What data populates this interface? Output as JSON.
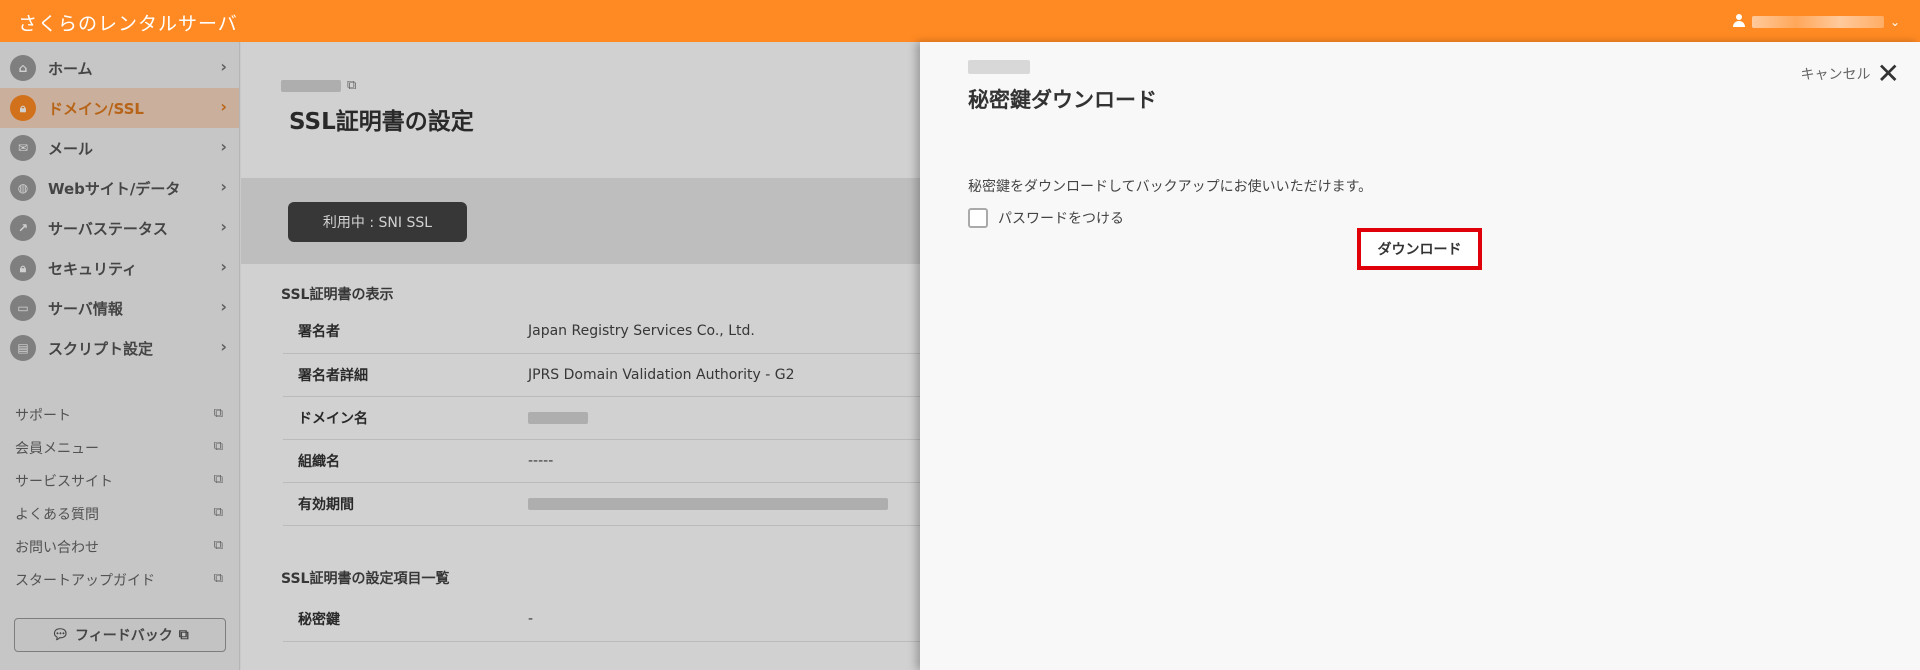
{
  "topbar": {
    "brand": "さくらのレンタルサーバ",
    "user_menu_chevron": "chevron-down-icon"
  },
  "sidebar": {
    "items": [
      {
        "label": "ホーム",
        "icon": "home-icon"
      },
      {
        "label": "ドメイン/SSL",
        "icon": "lock-icon",
        "active": true
      },
      {
        "label": "メール",
        "icon": "mail-icon"
      },
      {
        "label": "Webサイト/データ",
        "icon": "globe-icon"
      },
      {
        "label": "サーバステータス",
        "icon": "chart-icon"
      },
      {
        "label": "セキュリティ",
        "icon": "lock-icon"
      },
      {
        "label": "サーバ情報",
        "icon": "server-icon"
      },
      {
        "label": "スクリプト設定",
        "icon": "script-icon"
      }
    ],
    "links": [
      {
        "label": "サポート"
      },
      {
        "label": "会員メニュー"
      },
      {
        "label": "サービスサイト"
      },
      {
        "label": "よくある質問"
      },
      {
        "label": "お問い合わせ"
      },
      {
        "label": "スタートアップガイド"
      }
    ],
    "feedback_label": "フィードバック"
  },
  "main": {
    "page_title": "SSL証明書の設定",
    "status_label": "利用中 : SNI SSL",
    "section1_title": "SSL証明書の表示",
    "cert_rows": [
      {
        "key": "署名者",
        "value": "Japan Registry Services Co., Ltd."
      },
      {
        "key": "署名者詳細",
        "value": "JPRS Domain Validation Authority - G2"
      },
      {
        "key": "ドメイン名",
        "value": ""
      },
      {
        "key": "組織名",
        "value": "-----"
      },
      {
        "key": "有効期間",
        "value": ""
      }
    ],
    "section2_title": "SSL証明書の設定項目一覧",
    "settings_rows": [
      {
        "key": "秘密鍵",
        "value": "-"
      }
    ]
  },
  "panel": {
    "title": "秘密鍵ダウンロード",
    "cancel_label": "キャンセル",
    "description": "秘密鍵をダウンロードしてバックアップにお使いいただけます。",
    "password_option_label": "パスワードをつける",
    "password_checked": false,
    "download_label": "ダウンロード",
    "highlight_color": "#e0000a"
  },
  "colors": {
    "brand_orange": "#ff8a23",
    "active_bg": "#f7d7bf"
  }
}
